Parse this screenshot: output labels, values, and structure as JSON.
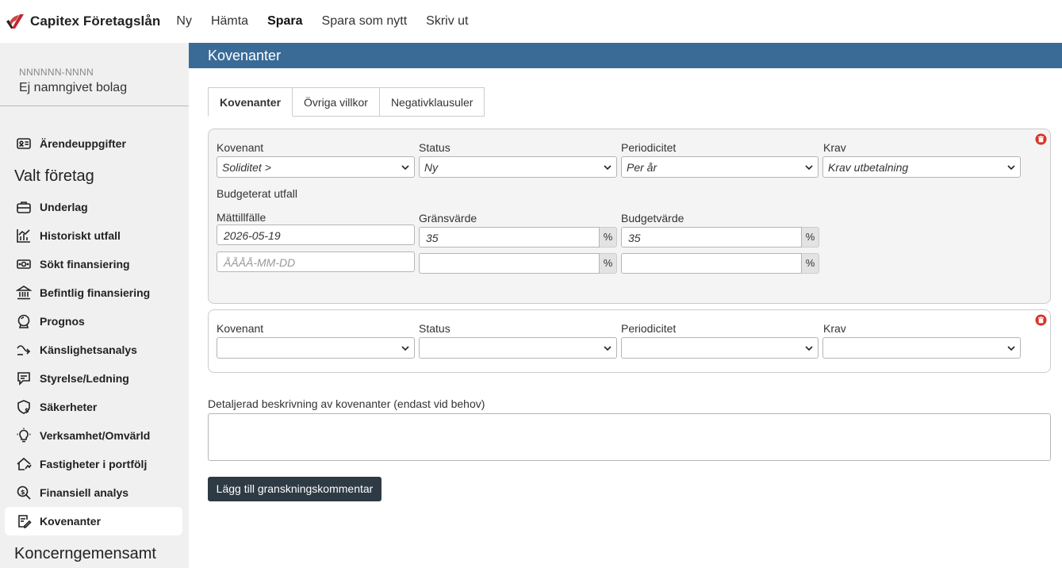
{
  "topbar": {
    "brand": "Capitex Företagslån",
    "nav": [
      "Ny",
      "Hämta",
      "Spara",
      "Spara som nytt",
      "Skriv ut"
    ]
  },
  "sidebar": {
    "org_number": "NNNNNN-NNNN",
    "org_name": "Ej namngivet bolag",
    "case_item": "Ärendeuppgifter",
    "section_selected": "Valt företag",
    "items": [
      "Underlag",
      "Historiskt utfall",
      "Sökt finansiering",
      "Befintlig finansiering",
      "Prognos",
      "Känslighetsanalys",
      "Styrelse/Ledning",
      "Säkerheter",
      "Verksamhet/Omvärld",
      "Fastigheter i portfölj",
      "Finansiell analys",
      "Kovenanter"
    ],
    "active_item": "Kovenanter",
    "section_group": "Koncerngemensamt"
  },
  "main": {
    "header": "Kovenanter",
    "tabs": [
      "Kovenanter",
      "Övriga villkor",
      "Negativklausuler"
    ],
    "active_tab": "Kovenanter"
  },
  "covenants": [
    {
      "labels": {
        "kovenant": "Kovenant",
        "status": "Status",
        "periodicitet": "Periodicitet",
        "krav": "Krav"
      },
      "kovenant": "Soliditet >",
      "status": "Ny",
      "periodicitet": "Per år",
      "krav": "Krav utbetalning",
      "budget_heading": "Budgeterat utfall",
      "col_labels": {
        "date": "Mättillfälle",
        "limit": "Gränsvärde",
        "budget": "Budgetvärde"
      },
      "rows": [
        {
          "date": "2026-05-19",
          "limit": "35",
          "budget": "35"
        },
        {
          "date_placeholder": "ÅÅÅÅ-MM-DD",
          "limit": "",
          "budget": ""
        }
      ],
      "unit": "%"
    },
    {
      "labels": {
        "kovenant": "Kovenant",
        "status": "Status",
        "periodicitet": "Periodicitet",
        "krav": "Krav"
      },
      "kovenant": "",
      "status": "",
      "periodicitet": "",
      "krav": ""
    }
  ],
  "description_label": "Detaljerad beskrivning av kovenanter (endast vid behov)",
  "review_button": "Lägg till granskningskommentar",
  "colors": {
    "header_blue": "#3a6b97",
    "delete_red": "#d9352b",
    "button_dark": "#2e3a44",
    "sidebar_bg": "#f0f0f0"
  }
}
